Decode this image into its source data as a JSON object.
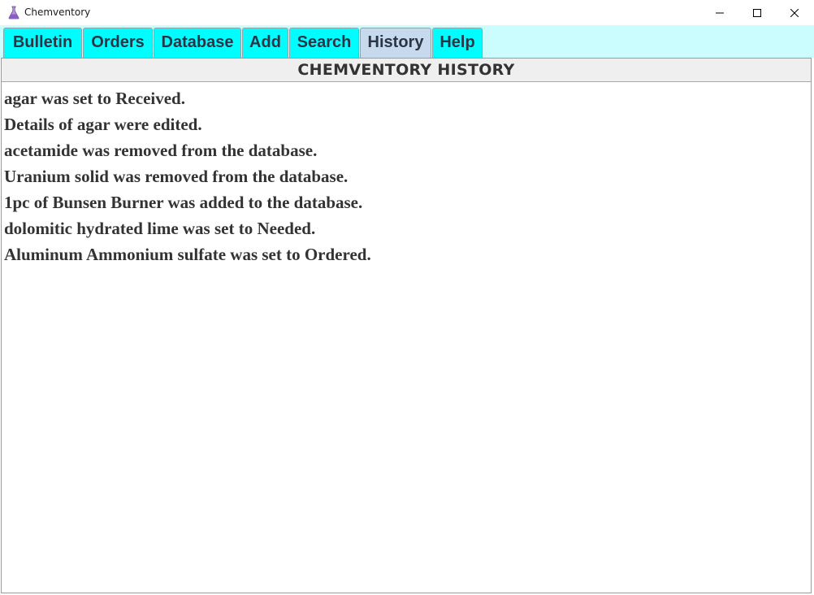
{
  "window": {
    "title": "Chemventory",
    "app_icon": "flask-icon",
    "controls": [
      "minimize-icon",
      "maximize-icon",
      "close-icon"
    ]
  },
  "tabs": [
    {
      "label": "Bulletin",
      "active": false
    },
    {
      "label": "Orders",
      "active": false
    },
    {
      "label": "Database",
      "active": false
    },
    {
      "label": "Add",
      "active": false
    },
    {
      "label": "Search",
      "active": false
    },
    {
      "label": "History",
      "active": true
    },
    {
      "label": "Help",
      "active": false
    }
  ],
  "history": {
    "title": "CHEMVENTORY HISTORY",
    "entries": [
      "agar was set to Received.",
      "Details of agar were edited.",
      "acetamide was removed from the database.",
      "Uranium solid was removed from the database.",
      "1pc of Bunsen Burner was added to the database.",
      "dolomitic hydrated lime was set to Needed.",
      "Aluminum Ammonium sulfate was set to Ordered."
    ]
  },
  "colors": {
    "tab_bg": "#00fdff",
    "tab_active_bg": "#c6d9ed",
    "tabstrip_bg": "#ccfdfe",
    "header_bg": "#efefef",
    "text": "#333333"
  }
}
